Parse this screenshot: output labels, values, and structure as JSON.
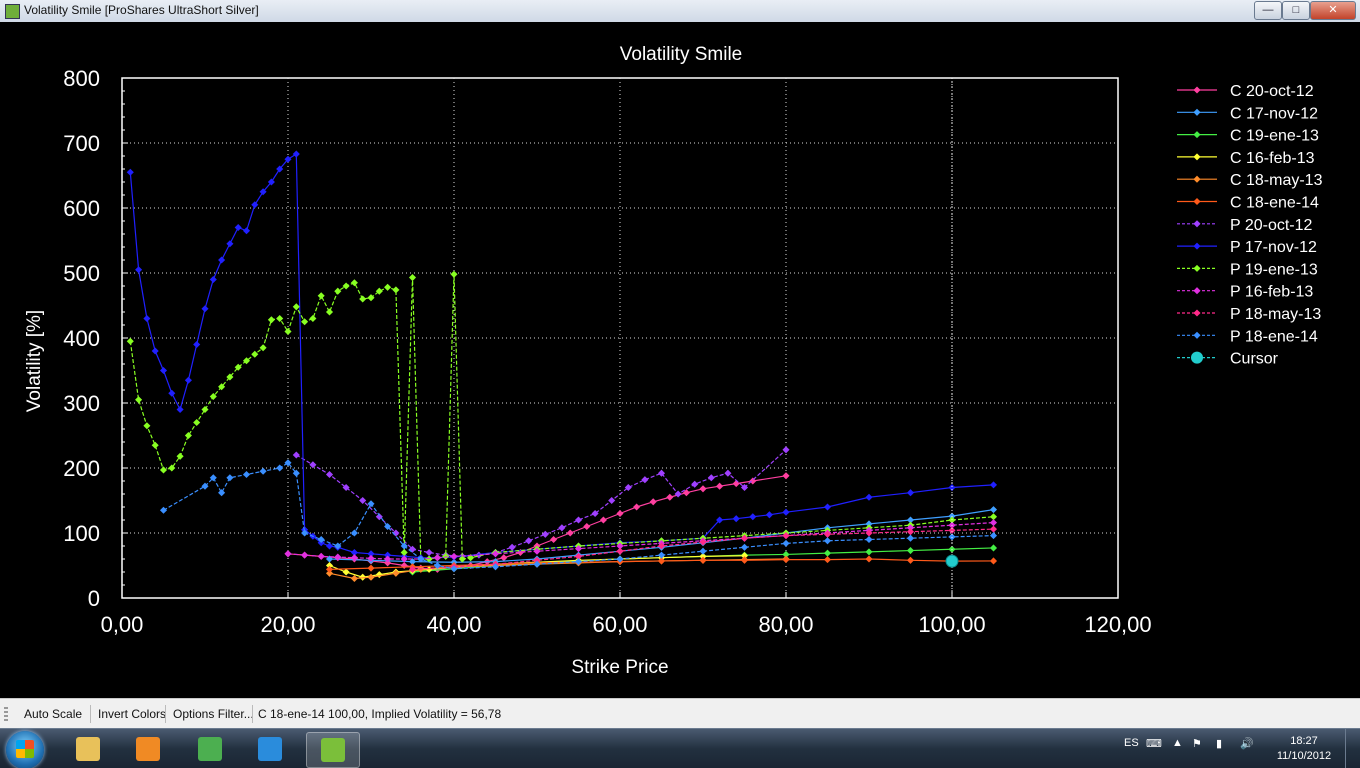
{
  "window": {
    "title": "Volatility Smile [ProShares UltraShort Silver]",
    "min_label": "—",
    "max_label": "□",
    "close_label": "✕"
  },
  "statusbar": {
    "auto_scale": "Auto Scale",
    "invert_colors": "Invert Colors",
    "options_filter": "Options Filter...",
    "cursor_readout": "C 18-ene-14 100,00, Implied Volatility = 56,78"
  },
  "taskbar": {
    "apps": [
      {
        "name": "explorer",
        "icon": "folder-icon",
        "color": "#e8c15a"
      },
      {
        "name": "media",
        "icon": "media-player-icon",
        "color": "#f08a24"
      },
      {
        "name": "chrome",
        "icon": "chrome-icon",
        "color": "#4caf50"
      },
      {
        "name": "ie",
        "icon": "internet-explorer-icon",
        "color": "#2a8cdc"
      },
      {
        "name": "volatility",
        "icon": "app-icon",
        "color": "#7bbf3a"
      }
    ],
    "lang": "ES",
    "time": "18:27",
    "date": "11/10/2012"
  },
  "chart_data": {
    "type": "line",
    "title": "Volatility Smile",
    "xlabel": "Strike Price",
    "ylabel": "Volatility [%]",
    "xlim": [
      0,
      120
    ],
    "ylim": [
      0,
      800
    ],
    "xticks": [
      "0,00",
      "20,00",
      "40,00",
      "60,00",
      "80,00",
      "100,00",
      "120,00"
    ],
    "yticks": [
      "0",
      "100",
      "200",
      "300",
      "400",
      "500",
      "600",
      "700",
      "800"
    ],
    "grid": true,
    "legend_position": "right",
    "series": [
      {
        "name": "C 20-oct-12",
        "color": "#ff3fa0",
        "dash": false,
        "x": [
          20,
          22,
          24,
          26,
          28,
          30,
          32,
          34,
          36,
          38,
          40,
          42,
          44,
          46,
          48,
          50,
          52,
          54,
          56,
          58,
          60,
          62,
          64,
          66,
          68,
          70,
          72,
          74,
          76,
          80
        ],
        "y": [
          68,
          66,
          64,
          62,
          60,
          57,
          54,
          50,
          46,
          44,
          45,
          50,
          56,
          62,
          70,
          80,
          90,
          100,
          110,
          120,
          130,
          140,
          148,
          155,
          162,
          168,
          172,
          176,
          180,
          188
        ]
      },
      {
        "name": "C 17-nov-12",
        "color": "#3f9fff",
        "dash": false,
        "x": [
          25,
          30,
          35,
          40,
          45,
          50,
          55,
          60,
          65,
          70,
          75,
          80,
          85,
          90,
          95,
          100,
          105
        ],
        "y": [
          60,
          58,
          56,
          55,
          56,
          60,
          66,
          72,
          78,
          85,
          92,
          100,
          108,
          114,
          120,
          126,
          136
        ]
      },
      {
        "name": "C 19-ene-13",
        "color": "#44ee44",
        "dash": false,
        "x": [
          35,
          40,
          45,
          50,
          55,
          60,
          65,
          70,
          75,
          80,
          85,
          90,
          95,
          100,
          105
        ],
        "y": [
          40,
          45,
          50,
          54,
          57,
          60,
          62,
          64,
          66,
          67,
          69,
          71,
          73,
          75,
          77
        ]
      },
      {
        "name": "C 16-feb-13",
        "color": "#ffff33",
        "dash": false,
        "x": [
          25,
          27,
          29,
          31,
          33,
          35,
          37,
          40,
          45,
          50,
          55,
          60,
          65,
          70,
          75
        ],
        "y": [
          50,
          40,
          32,
          36,
          40,
          42,
          44,
          48,
          52,
          55,
          58,
          60,
          62,
          64,
          65
        ]
      },
      {
        "name": "C 18-may-13",
        "color": "#ff8c2a",
        "dash": false,
        "x": [
          25,
          28,
          30,
          33,
          36,
          40,
          45,
          50,
          55,
          60,
          65,
          70,
          75,
          80
        ],
        "y": [
          38,
          30,
          32,
          38,
          44,
          48,
          50,
          52,
          54,
          56,
          57,
          58,
          59,
          60
        ]
      },
      {
        "name": "C 18-ene-14",
        "color": "#ff5a1a",
        "dash": false,
        "x": [
          25,
          30,
          35,
          40,
          45,
          50,
          55,
          60,
          65,
          70,
          75,
          80,
          85,
          90,
          95,
          100,
          105
        ],
        "y": [
          44,
          46,
          48,
          50,
          52,
          54,
          55,
          56,
          57,
          58,
          58,
          59,
          59,
          60,
          58,
          56.78,
          57
        ]
      },
      {
        "name": "P 20-oct-12",
        "color": "#a040ff",
        "dash": true,
        "x": [
          21,
          23,
          25,
          27,
          29,
          31,
          33,
          35,
          37,
          39,
          41,
          43,
          45,
          47,
          49,
          51,
          53,
          55,
          57,
          59,
          61,
          63,
          65,
          67,
          69,
          71,
          73,
          75,
          80
        ],
        "y": [
          220,
          205,
          190,
          170,
          150,
          125,
          100,
          75,
          70,
          66,
          64,
          66,
          70,
          78,
          88,
          98,
          108,
          120,
          130,
          150,
          170,
          182,
          192,
          160,
          175,
          185,
          192,
          170,
          228
        ]
      },
      {
        "name": "P 17-nov-12",
        "color": "#2020ff",
        "dash": false,
        "x": [
          1,
          2,
          3,
          4,
          5,
          6,
          7,
          8,
          9,
          10,
          11,
          12,
          13,
          14,
          15,
          16,
          17,
          18,
          19,
          20,
          21,
          22,
          23,
          24,
          25,
          26,
          28,
          30,
          32,
          34,
          36,
          38,
          40,
          45,
          50,
          55,
          60,
          65,
          70,
          72,
          74,
          76,
          78,
          80,
          85,
          90,
          95,
          100,
          105
        ],
        "y": [
          655,
          505,
          430,
          380,
          350,
          315,
          290,
          335,
          390,
          445,
          490,
          520,
          545,
          570,
          565,
          605,
          625,
          640,
          660,
          675,
          683,
          105,
          95,
          85,
          80,
          78,
          70,
          68,
          66,
          64,
          62,
          62,
          63,
          70,
          75,
          80,
          85,
          88,
          92,
          120,
          122,
          125,
          128,
          132,
          140,
          155,
          162,
          170,
          174
        ]
      },
      {
        "name": "P 19-ene-13",
        "color": "#88ff22",
        "dash": true,
        "x": [
          1,
          2,
          3,
          4,
          5,
          6,
          7,
          8,
          9,
          10,
          11,
          12,
          13,
          14,
          15,
          16,
          17,
          18,
          19,
          20,
          21,
          22,
          23,
          24,
          25,
          26,
          27,
          28,
          29,
          30,
          31,
          32,
          33,
          34,
          35,
          36,
          37,
          38,
          39,
          40,
          41,
          42,
          45,
          50,
          55,
          60,
          65,
          70,
          75,
          80,
          85,
          90,
          95,
          100,
          105
        ],
        "y": [
          395,
          305,
          265,
          235,
          197,
          200,
          218,
          250,
          270,
          290,
          310,
          325,
          340,
          355,
          365,
          375,
          385,
          428,
          430,
          410,
          448,
          425,
          430,
          465,
          440,
          472,
          480,
          485,
          460,
          462,
          472,
          478,
          474,
          70,
          493,
          60,
          60,
          62,
          64,
          498,
          60,
          62,
          70,
          75,
          80,
          84,
          88,
          92,
          96,
          100,
          104,
          108,
          112,
          120,
          125
        ]
      },
      {
        "name": "P 16-feb-13",
        "color": "#e030e0",
        "dash": true,
        "x": [
          20,
          22,
          24,
          26,
          28,
          30,
          32,
          34,
          36,
          38,
          40,
          45,
          50,
          55,
          60,
          65,
          70,
          75,
          80,
          85,
          90,
          95,
          100,
          105
        ],
        "y": [
          68,
          66,
          64,
          63,
          62,
          61,
          60,
          60,
          60,
          62,
          64,
          68,
          72,
          76,
          80,
          84,
          88,
          92,
          96,
          100,
          104,
          108,
          112,
          116
        ]
      },
      {
        "name": "P 18-may-13",
        "color": "#ff2a8a",
        "dash": true,
        "x": [
          35,
          40,
          45,
          50,
          55,
          60,
          65,
          70,
          75,
          80,
          85,
          90,
          95,
          100,
          105
        ],
        "y": [
          44,
          48,
          52,
          58,
          64,
          72,
          80,
          86,
          92,
          96,
          98,
          100,
          102,
          104,
          106
        ]
      },
      {
        "name": "P 18-ene-14",
        "color": "#3a8fff",
        "dash": true,
        "x": [
          5,
          10,
          11,
          12,
          13,
          15,
          17,
          19,
          20,
          21,
          22,
          24,
          26,
          28,
          30,
          32,
          34,
          36,
          38,
          40,
          45,
          50,
          55,
          60,
          65,
          70,
          75,
          80,
          85,
          90,
          95,
          100,
          105
        ],
        "y": [
          135,
          172,
          185,
          162,
          185,
          190,
          195,
          200,
          208,
          192,
          100,
          90,
          80,
          100,
          145,
          110,
          80,
          60,
          50,
          45,
          48,
          52,
          56,
          60,
          66,
          72,
          78,
          84,
          88,
          90,
          92,
          94,
          96
        ]
      }
    ],
    "cursor": {
      "name": "Cursor",
      "color": "#22cccc",
      "x": 100,
      "y": 56.78
    }
  }
}
